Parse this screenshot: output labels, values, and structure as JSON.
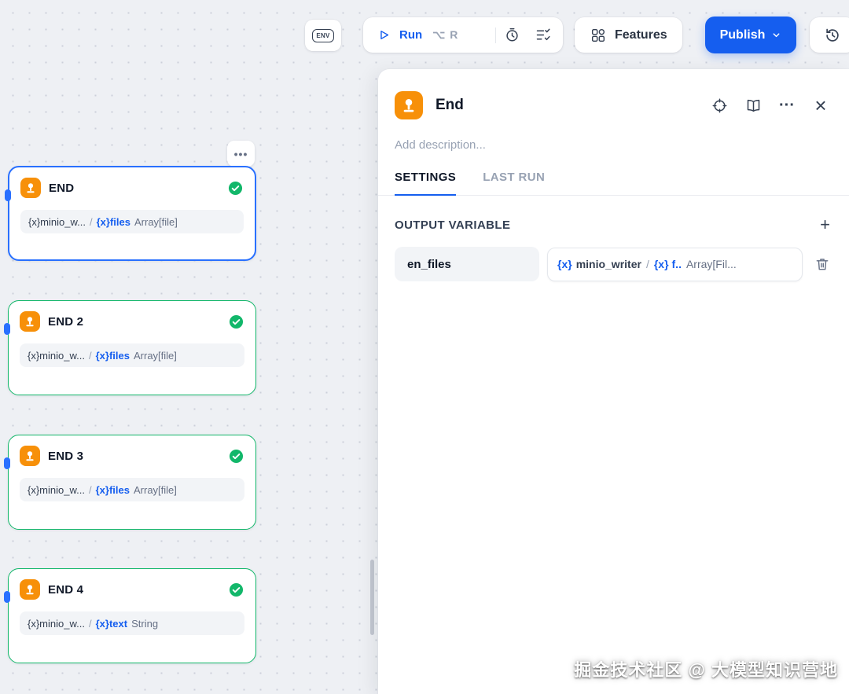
{
  "colors": {
    "accent": "#155eef",
    "selected_border": "#2970ff",
    "success_green": "#12b76a",
    "node_icon_orange": "#f79009"
  },
  "toolbar": {
    "env_label": "ENV",
    "run": {
      "label": "Run",
      "shortcut": "⌥ R"
    },
    "features_label": "Features",
    "publish_label": "Publish"
  },
  "canvas": {
    "more_icon": "•••",
    "nodes": [
      {
        "title": "END",
        "var_source": "{x}minio_w...",
        "sep": "/",
        "var_name": "{x}files",
        "var_type": "Array[file]"
      },
      {
        "title": "END 2",
        "var_source": "{x}minio_w...",
        "sep": "/",
        "var_name": "{x}files",
        "var_type": "Array[file]"
      },
      {
        "title": "END 3",
        "var_source": "{x}minio_w...",
        "sep": "/",
        "var_name": "{x}files",
        "var_type": "Array[file]"
      },
      {
        "title": "END 4",
        "var_source": "{x}minio_w...",
        "sep": "/",
        "var_name": "{x}text",
        "var_type": "String"
      }
    ]
  },
  "panel": {
    "title": "End",
    "description_placeholder": "Add description...",
    "more_icon": "···",
    "close_icon": "×",
    "tabs": {
      "settings": "SETTINGS",
      "last_run": "LAST RUN"
    },
    "output_variable": {
      "section_title": "OUTPUT VARIABLE",
      "plus_icon": "+",
      "row": {
        "name": "en_files",
        "value_node_icon": "{x}",
        "value_node": "minio_writer",
        "sep": "/",
        "value_var_icon": "{x}",
        "value_var": "f..",
        "value_type": "Array[Fil..."
      }
    }
  },
  "watermark": "掘金技术社区 @ 大模型知识营地"
}
